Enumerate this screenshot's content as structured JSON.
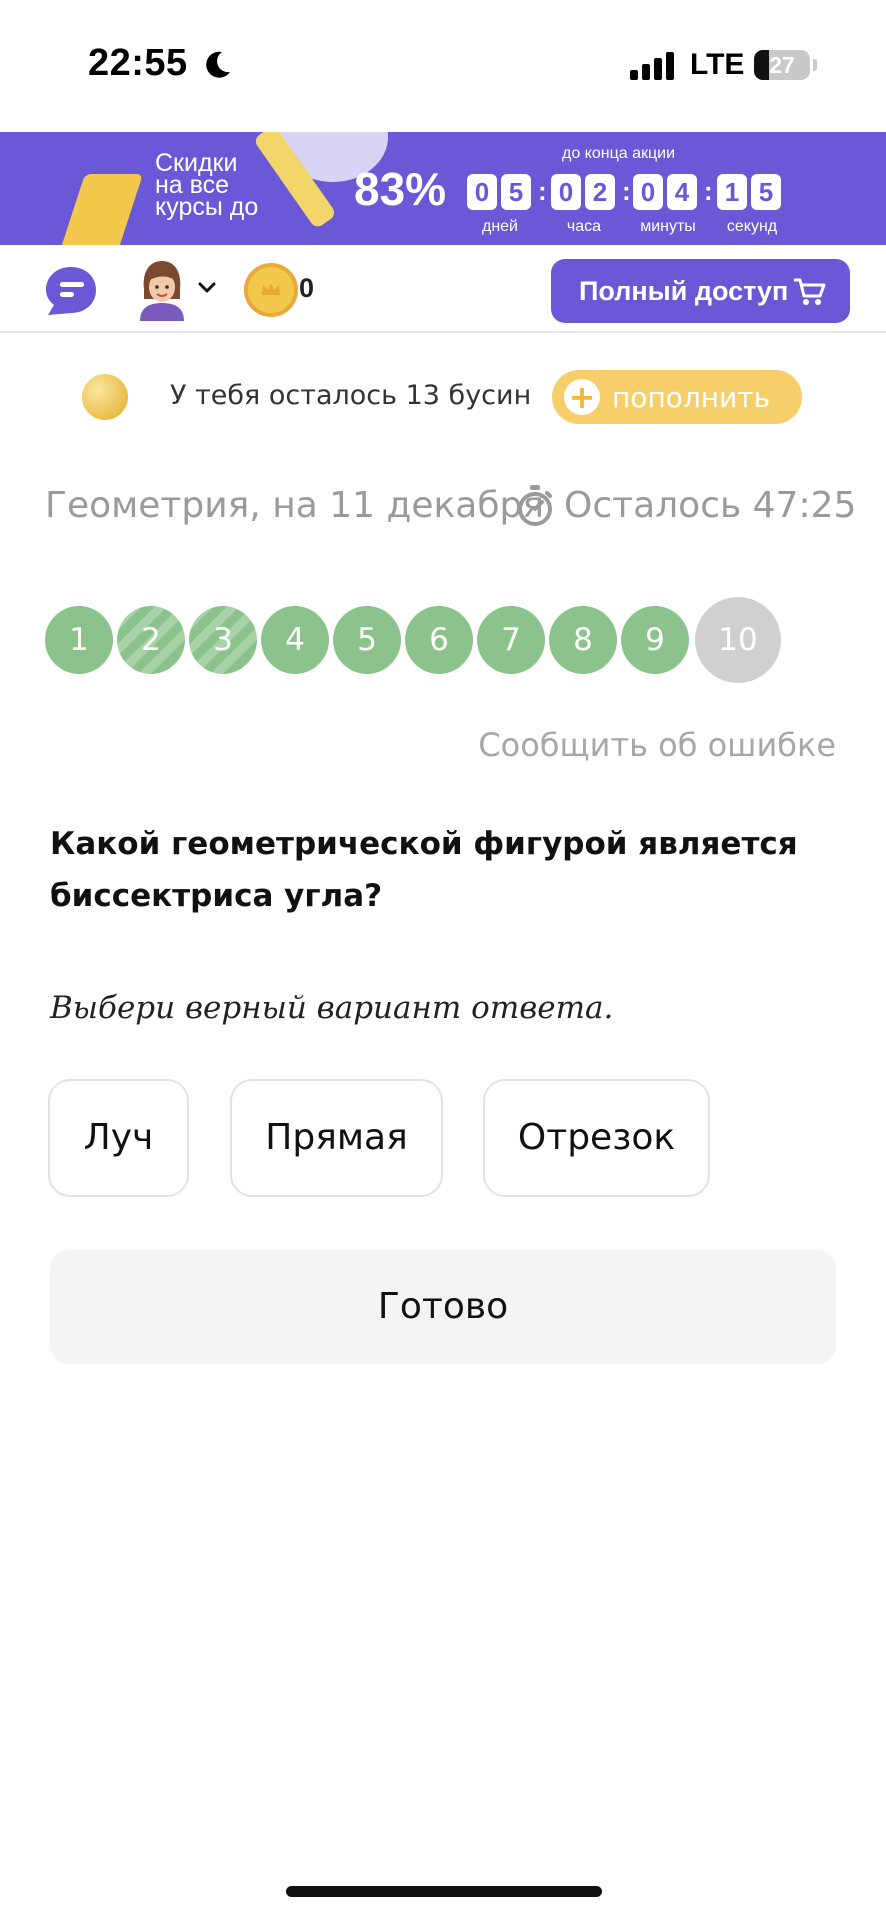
{
  "status_bar": {
    "time": "22:55",
    "network": "LTE",
    "battery": "27",
    "battery_level_percent": 27
  },
  "promo": {
    "text_line1": "Скидки",
    "text_line2": "на все",
    "text_line3": "курсы до",
    "percent": "83%",
    "until_label": "до конца акции",
    "days_digits": [
      "0",
      "5"
    ],
    "hours_digits": [
      "0",
      "2"
    ],
    "minutes_digits": [
      "0",
      "4"
    ],
    "seconds_digits": [
      "1",
      "5"
    ],
    "separator": ":",
    "days_label": "дней",
    "hours_label": "часа",
    "minutes_label": "минуты",
    "seconds_label": "секунд",
    "accent_color": "#6b58d6"
  },
  "nav": {
    "coin_count": "0",
    "full_access_label": "Полный доступ"
  },
  "beads": {
    "text": "У тебя осталось 13 бусин",
    "refill_label": "пополнить"
  },
  "lesson": {
    "title": "Геометрия, на 11 декабря",
    "remaining": "Осталось 47:25"
  },
  "progress": {
    "circles": [
      {
        "label": "1",
        "state": "done"
      },
      {
        "label": "2",
        "state": "striped"
      },
      {
        "label": "3",
        "state": "striped"
      },
      {
        "label": "4",
        "state": "done"
      },
      {
        "label": "5",
        "state": "done"
      },
      {
        "label": "6",
        "state": "done"
      },
      {
        "label": "7",
        "state": "done"
      },
      {
        "label": "8",
        "state": "done"
      },
      {
        "label": "9",
        "state": "done"
      },
      {
        "label": "10",
        "state": "current"
      }
    ],
    "done_color": "#8cc38c",
    "current_color": "#d0d0d0"
  },
  "report_label": "Сообщить об ошибке",
  "question": {
    "line1": "Какой геометрической фигурой является",
    "line2": "биссектриса угла?",
    "hint": "Выбери верный вариант ответа."
  },
  "options": [
    "Луч",
    "Прямая",
    "Отрезок"
  ],
  "done_label": "Готово"
}
